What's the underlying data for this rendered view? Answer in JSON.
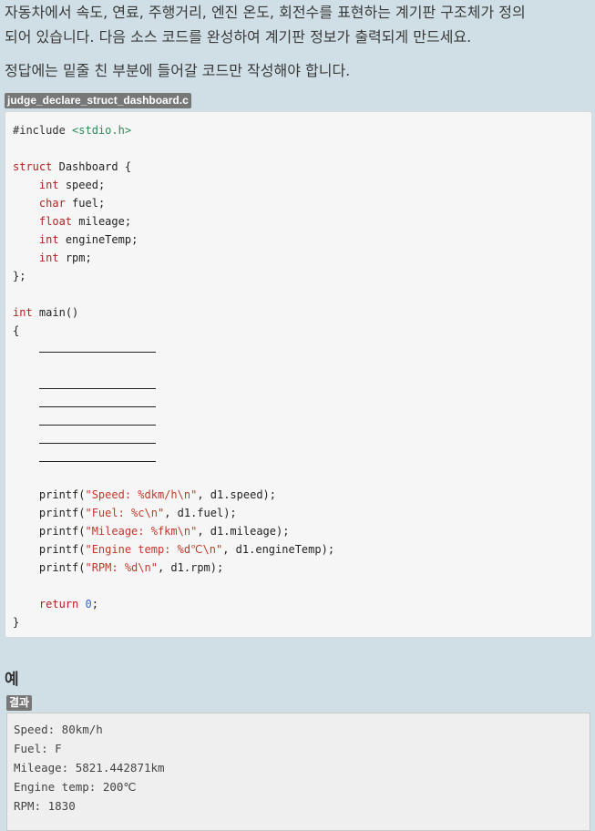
{
  "description": {
    "line1": "자동차에서 속도, 연료, 주행거리, 엔진 온도, 회전수를 표현하는 계기판 구조체가 정의",
    "line2": "되어 있습니다. 다음 소스 코드를 완성하여 계기판 정보가 출력되게 만드세요.",
    "note": "정답에는 밑줄 친 부분에 들어갈 코드만 작성해야 합니다."
  },
  "file": {
    "name": "judge_declare_struct_dashboard.c"
  },
  "code": {
    "include_kw": "#include",
    "include_hdr": "<stdio.h>",
    "struct_kw": "struct",
    "struct_name": "Dashboard {",
    "fields": [
      {
        "type": "int",
        "name": "speed;"
      },
      {
        "type": "char",
        "name": "fuel;"
      },
      {
        "type": "float",
        "name": "mileage;"
      },
      {
        "type": "int",
        "name": "engineTemp;"
      },
      {
        "type": "int",
        "name": "rpm;"
      }
    ],
    "struct_close": "};",
    "main_kw": "int",
    "main_sig": "main()",
    "open_brace": "{",
    "printfs": [
      {
        "fn": "printf(",
        "fmt": "\"Speed: %dkm/h\\n\"",
        "arg": ", d1.speed);"
      },
      {
        "fn": "printf(",
        "fmt": "\"Fuel: %c\\n\"",
        "arg": ", d1.fuel);"
      },
      {
        "fn": "printf(",
        "fmt": "\"Mileage: %fkm\\n\"",
        "arg": ", d1.mileage);"
      },
      {
        "fn": "printf(",
        "fmt": "\"Engine temp: %d℃\\n\"",
        "arg": ", d1.engineTemp);"
      },
      {
        "fn": "printf(",
        "fmt": "\"RPM: %d\\n\"",
        "arg": ", d1.rpm);"
      }
    ],
    "return_kw": "return",
    "return_val": "0",
    "return_end": ";",
    "close_brace": "}"
  },
  "example": {
    "title": "예",
    "result_label": "결과",
    "output": [
      "Speed: 80km/h",
      "Fuel: F",
      "Mileage: 5821.442871km",
      "Engine temp: 200℃",
      "RPM: 1830"
    ]
  }
}
